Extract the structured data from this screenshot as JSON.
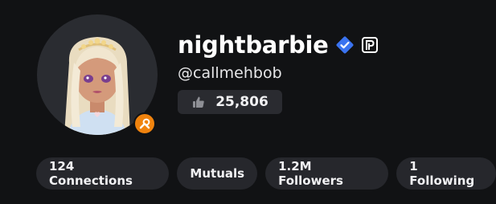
{
  "profile": {
    "display_name": "nightbarbie",
    "username": "@callmehbob",
    "likes": "25,806",
    "verified_color": "#3a73f0",
    "badge_color": "#f0830e",
    "icons": {
      "verified": "verified-badge-icon",
      "premium": "premium-icon",
      "likes": "thumbs-up-icon",
      "tool_badge": "wrench-icon"
    }
  },
  "stats": [
    {
      "label": "124 Connections"
    },
    {
      "label": "Mutuals"
    },
    {
      "label": "1.2M Followers"
    },
    {
      "label": "1 Following"
    }
  ]
}
